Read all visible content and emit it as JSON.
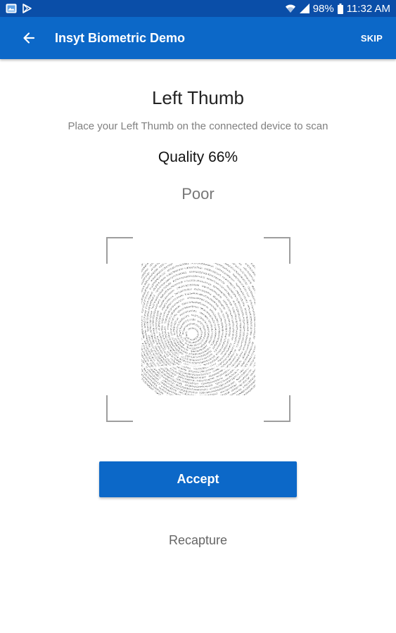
{
  "status_bar": {
    "battery": "98%",
    "time": "11:32 AM",
    "icons": [
      "gallery-icon",
      "play-store-icon",
      "wifi-icon",
      "signal-icon",
      "battery-icon"
    ]
  },
  "app_bar": {
    "title": "Insyt Biometric Demo",
    "skip_label": "SKIP",
    "back_icon": "arrow-back-icon"
  },
  "capture": {
    "finger": "Left Thumb",
    "instruction": "Place your Left Thumb on the connected device to scan",
    "quality_text": "Quality 66%",
    "quality_value": 66,
    "quality_rating": "Poor"
  },
  "actions": {
    "accept_label": "Accept",
    "recapture_label": "Recapture"
  },
  "colors": {
    "primary": "#0c68c8",
    "status_bar": "#0a4ea8"
  }
}
